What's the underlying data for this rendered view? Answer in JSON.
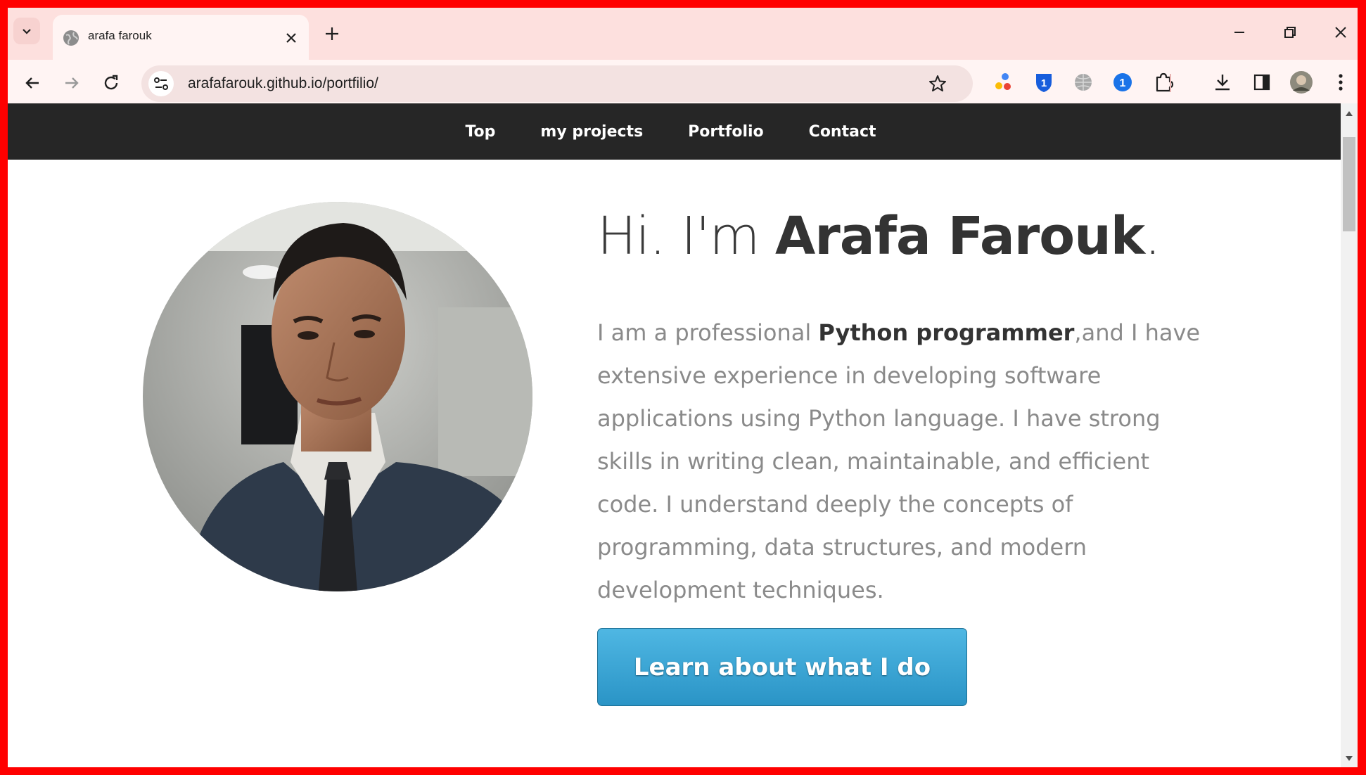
{
  "browser": {
    "tab": {
      "title": "arafa farouk"
    },
    "address_bar": {
      "url": "arafafarouk.github.io/portfilio/"
    },
    "extensions": [
      {
        "name": "colored-dots-extension-icon"
      },
      {
        "name": "bitwarden-shield-icon",
        "badge": "1"
      },
      {
        "name": "globe-extension-icon"
      },
      {
        "name": "blue-badge-extension-icon",
        "badge": "1"
      },
      {
        "name": "puzzle-extensions-icon"
      }
    ],
    "colors": {
      "tabstrip": "#fde0de",
      "toolbar": "#fff4f3",
      "frame": "#ff0000"
    }
  },
  "site": {
    "nav": {
      "items": [
        {
          "label": "Top"
        },
        {
          "label": "my projects"
        },
        {
          "label": "Portfolio"
        },
        {
          "label": "Contact"
        }
      ]
    },
    "hero": {
      "greeting": "Hi. I'm ",
      "name": "Arafa Farouk",
      "name_suffix": ".",
      "bio_prefix": "I am a professional ",
      "bio_highlight": "Python programmer",
      "bio_rest": ",and I have extensive experience in developing software applications using Python language. I have strong skills in writing clean, maintainable, and efficient code. I understand deeply the concepts of programming, data structures, and modern development techniques.",
      "cta_label": "Learn about what I do"
    },
    "colors": {
      "navbar": "#262626",
      "cta": "#3aa5d6",
      "text_muted": "#8a8a8a",
      "text_dark": "#333333"
    }
  }
}
